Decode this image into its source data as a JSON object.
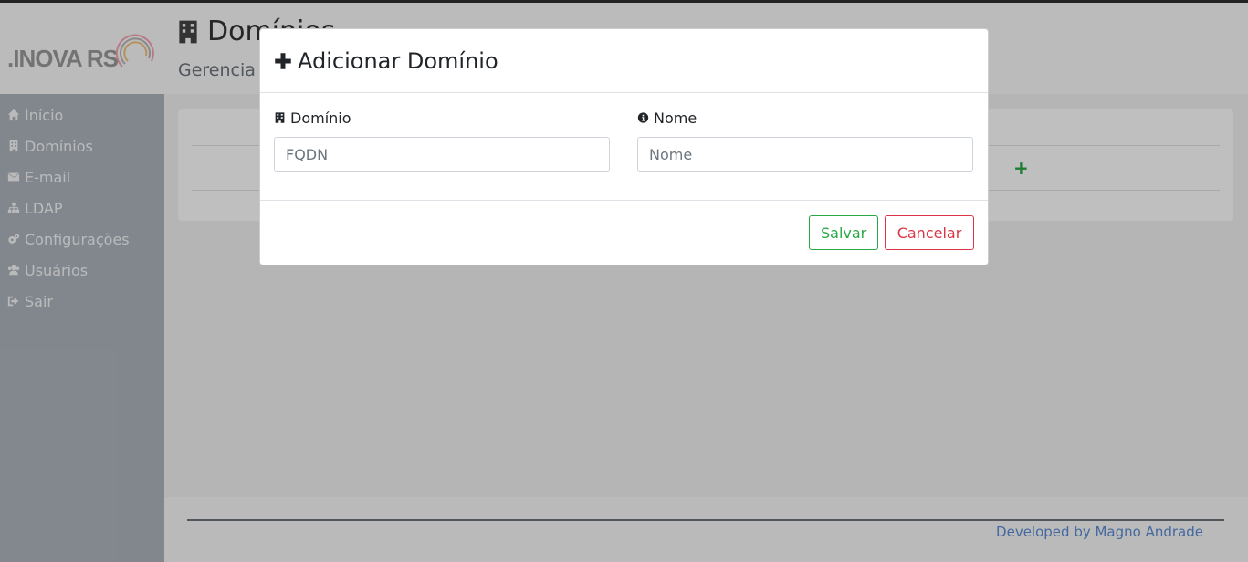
{
  "brand": {
    "logo_text": ".INOVA RS"
  },
  "sidebar": {
    "items": [
      {
        "label": "Início",
        "icon": "home-icon"
      },
      {
        "label": "Domínios",
        "icon": "building-icon"
      },
      {
        "label": "E-mail",
        "icon": "envelope-icon"
      },
      {
        "label": "LDAP",
        "icon": "sitemap-icon"
      },
      {
        "label": "Configurações",
        "icon": "gears-icon"
      },
      {
        "label": "Usuários",
        "icon": "users-icon"
      },
      {
        "label": "Sair",
        "icon": "sign-out-icon"
      }
    ]
  },
  "page": {
    "title": "Domínios",
    "subtitle": "Gerencia",
    "add_symbol": "+"
  },
  "modal": {
    "title": "Adicionar Domínio",
    "fields": {
      "domain": {
        "label": "Domínio",
        "placeholder": "FQDN",
        "value": ""
      },
      "name": {
        "label": "Nome",
        "placeholder": "Nome",
        "value": ""
      }
    },
    "buttons": {
      "save": "Salvar",
      "cancel": "Cancelar"
    }
  },
  "footer": {
    "credit": "Developed by Magno Andrade"
  },
  "colors": {
    "sidebar_bg": "#adb5bd",
    "success": "#28a745",
    "danger": "#dc3545",
    "link": "#5b8bd6"
  }
}
